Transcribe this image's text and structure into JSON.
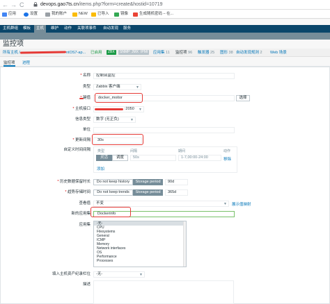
{
  "browser": {
    "url_host": "devops.gao7ts.cn",
    "url_path": "/items.php?form=create&hostid=10719",
    "nav": {
      "back": "←",
      "forward": "→",
      "reload": "C"
    },
    "bookmarks": [
      {
        "label": "应用",
        "color": "#4285f4"
      },
      {
        "label": "设置",
        "color": "#1a73e8"
      },
      {
        "label": "我的账户",
        "color": "#9aa0a6"
      },
      {
        "label": "NEW",
        "color": "#fbbc05"
      },
      {
        "label": "已导入",
        "color": "#fbbc05"
      },
      {
        "label": "镜像",
        "color": "#34a853"
      },
      {
        "label": "生成随机密码 – 在...",
        "color": "#ea4335"
      }
    ]
  },
  "topnav": {
    "items": [
      "主机群组",
      "模板",
      "主机",
      "维护",
      "动作",
      "关联项事件",
      "自动发现",
      "服务"
    ],
    "active_index": 2
  },
  "page_title": "监控项",
  "breadcrumbs": {
    "all_hosts": "所有主机 /",
    "host_name_suffix": "ntOS7-ap...",
    "status_enabled": "已启用",
    "zbx": "ZBX",
    "snmp": "SNMP",
    "jmx": "JMX",
    "ipmi": "IPMI",
    "apps": {
      "label": "应用集",
      "count": "11"
    },
    "items": {
      "label": "监控项",
      "count": "96"
    },
    "triggers": {
      "label": "触发器",
      "count": "25"
    },
    "graphs": {
      "label": "图形",
      "count": "38"
    },
    "discovery": {
      "label": "自动发现规则",
      "count": "2"
    },
    "web": {
      "label": "Web 场景",
      "count": ""
    }
  },
  "tabs": [
    "监控项",
    "进程"
  ],
  "form": {
    "name": {
      "label": "名称",
      "value": "控制台监控"
    },
    "type": {
      "label": "类型",
      "value": "Zabbix 客户端"
    },
    "key": {
      "label": "键值",
      "value": "docker_moitor",
      "select_button": "选择"
    },
    "host_interface": {
      "label": "主机接口",
      "value_suffix": ":2050"
    },
    "info_type": {
      "label": "信息类型",
      "value": "数字 (无正负)"
    },
    "units": {
      "label": "单位",
      "value": ""
    },
    "update_interval": {
      "label": "更新间隔",
      "value": "30s"
    },
    "custom_intervals": {
      "label": "自定义时间间隔",
      "headers": [
        "类型",
        "间隔",
        "期间",
        "动作"
      ],
      "row": {
        "flexible": "灵活",
        "scheduling": "调度",
        "interval": "50s",
        "period": "1-7,00:00-24:00",
        "remove": "移除"
      },
      "add": "添加"
    },
    "history": {
      "label": "历史数据保留时长",
      "do_not_keep": "Do not keep history",
      "storage_period": "Storage period",
      "value": "90d"
    },
    "trends": {
      "label": "趋势存储时间",
      "do_not_keep": "Do not keep trends",
      "storage_period": "Storage period",
      "value": "365d"
    },
    "show_value": {
      "label": "查看值",
      "value": "不变",
      "mapping_link": "展示值映射"
    },
    "new_app": {
      "label": "新的应用集",
      "value": "Dockerinfo"
    },
    "apps": {
      "label": "应用集",
      "options": [
        "-无-",
        "CPU",
        "Filesystems",
        "General",
        "ICMP",
        "Memory",
        "Network interfaces",
        "OS",
        "Performance",
        "Processes"
      ],
      "selected_index": 0
    },
    "inventory": {
      "label": "填入主机资产纪录栏位",
      "value": "-无-"
    },
    "description": {
      "label": "描述"
    }
  },
  "colors": {
    "topnav": "#0a466a",
    "subnav": "#768d99",
    "link": "#0275b8",
    "enabled": "#1b9a46",
    "annotation": "#e53935"
  }
}
